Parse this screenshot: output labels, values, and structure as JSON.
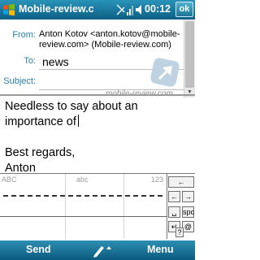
{
  "titlebar": {
    "title": "Mobile-review.c",
    "clock": "00:12",
    "ok_label": "ok"
  },
  "header": {
    "from_label": "From:",
    "from_value": "Anton Kotov <anton.kotov@mobile-review.com> (Mobile-review.com)",
    "to_label": "To:",
    "to_value": "news",
    "subject_label": "Subject:"
  },
  "watermark": {
    "text": "mobile-review.com"
  },
  "body": {
    "text": "Needless to say about an\nimportance of\n\nBest regards,\nAnton"
  },
  "input_panel": {
    "zones": [
      "ABC",
      "abc",
      "123"
    ],
    "keys": {
      "backspace": "←",
      "space": "→",
      "spc": "spc",
      "enter": "↵",
      "question": "?",
      "at": "@"
    }
  },
  "softkeys": {
    "left": "Send",
    "right": "Menu"
  },
  "colors": {
    "bar": "#0c5f85",
    "label": "#2a7fa5"
  }
}
